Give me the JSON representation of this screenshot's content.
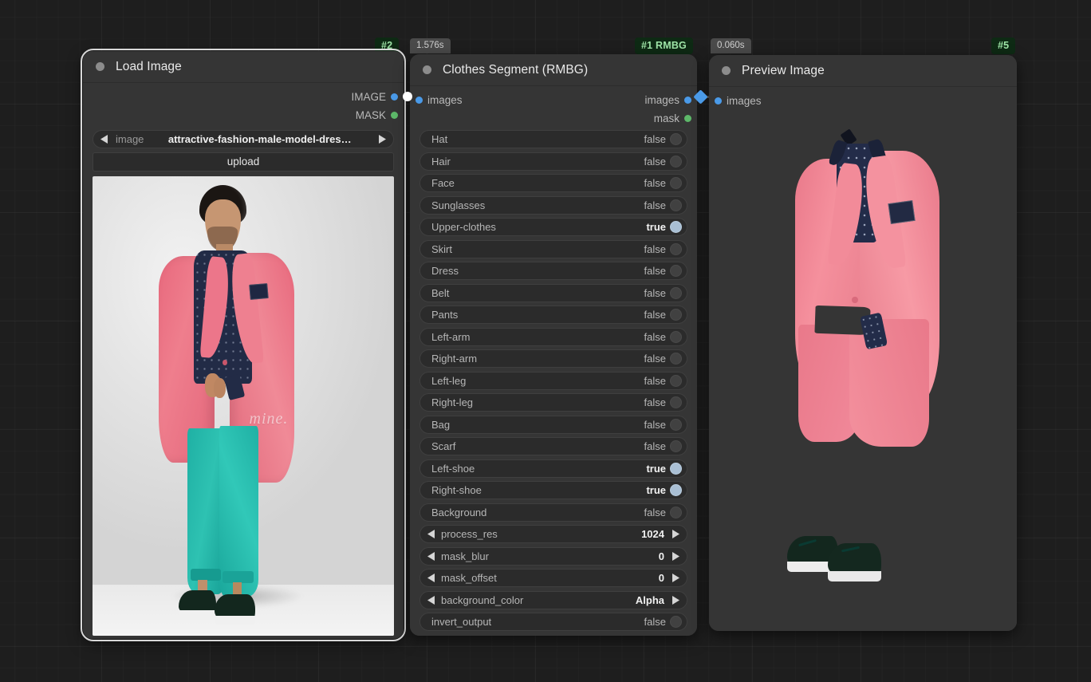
{
  "app": {
    "canvas_label": "node-graph-canvas"
  },
  "nodes": [
    {
      "key": "load_image",
      "title": "Load Image",
      "id_badge": "#2",
      "time_badge": null,
      "selected": true,
      "outputs": [
        {
          "label": "IMAGE",
          "type": "IMAGE",
          "color": "#4a9ae8"
        },
        {
          "label": "MASK",
          "type": "MASK",
          "color": "#5db869"
        }
      ],
      "inputs": [],
      "widgets": [
        {
          "kind": "combo",
          "name": "image",
          "value": "attractive-fashion-male-model-dres…"
        },
        {
          "kind": "button",
          "label": "upload"
        }
      ],
      "preview_alt": "attractive fashion male model in pink blazer, navy shirt, teal trousers and dark derby shoes"
    },
    {
      "key": "clothes_segment",
      "title": "Clothes Segment (RMBG)",
      "id_badge": "#1 RMBG",
      "time_badge": "1.576s",
      "selected": false,
      "inputs": [
        {
          "label": "images",
          "type": "IMAGE",
          "color": "#4a9ae8"
        }
      ],
      "outputs": [
        {
          "label": "images",
          "type": "IMAGE",
          "color": "#4a9ae8"
        },
        {
          "label": "mask",
          "type": "MASK",
          "color": "#5db869"
        }
      ],
      "widgets": [
        {
          "kind": "toggle",
          "name": "Hat",
          "value": "false"
        },
        {
          "kind": "toggle",
          "name": "Hair",
          "value": "false"
        },
        {
          "kind": "toggle",
          "name": "Face",
          "value": "false"
        },
        {
          "kind": "toggle",
          "name": "Sunglasses",
          "value": "false"
        },
        {
          "kind": "toggle",
          "name": "Upper-clothes",
          "value": "true"
        },
        {
          "kind": "toggle",
          "name": "Skirt",
          "value": "false"
        },
        {
          "kind": "toggle",
          "name": "Dress",
          "value": "false"
        },
        {
          "kind": "toggle",
          "name": "Belt",
          "value": "false"
        },
        {
          "kind": "toggle",
          "name": "Pants",
          "value": "false"
        },
        {
          "kind": "toggle",
          "name": "Left-arm",
          "value": "false"
        },
        {
          "kind": "toggle",
          "name": "Right-arm",
          "value": "false"
        },
        {
          "kind": "toggle",
          "name": "Left-leg",
          "value": "false"
        },
        {
          "kind": "toggle",
          "name": "Right-leg",
          "value": "false"
        },
        {
          "kind": "toggle",
          "name": "Bag",
          "value": "false"
        },
        {
          "kind": "toggle",
          "name": "Scarf",
          "value": "false"
        },
        {
          "kind": "toggle",
          "name": "Left-shoe",
          "value": "true"
        },
        {
          "kind": "toggle",
          "name": "Right-shoe",
          "value": "true"
        },
        {
          "kind": "toggle",
          "name": "Background",
          "value": "false"
        },
        {
          "kind": "combo",
          "name": "process_res",
          "value": "1024"
        },
        {
          "kind": "combo",
          "name": "mask_blur",
          "value": "0"
        },
        {
          "kind": "combo",
          "name": "mask_offset",
          "value": "0"
        },
        {
          "kind": "combo",
          "name": "background_color",
          "value": "Alpha"
        },
        {
          "kind": "toggle",
          "name": "invert_output",
          "value": "false"
        }
      ]
    },
    {
      "key": "preview_image",
      "title": "Preview Image",
      "id_badge": "#5",
      "time_badge": "0.060s",
      "selected": false,
      "inputs": [
        {
          "label": "images",
          "type": "IMAGE",
          "color": "#4a9ae8"
        }
      ],
      "outputs": [],
      "widgets": [],
      "preview_alt": "segmented pink blazer with navy shirt and pair of dark derby shoes on transparent background"
    }
  ],
  "colors": {
    "canvas_bg": "#1e1e1e",
    "node_bg": "#353535",
    "widget_bg": "#2b2b2b",
    "image_slot": "#4a9ae8",
    "mask_slot": "#5db869",
    "badge_bg": "#0e2a14",
    "badge_text": "#9fe6a8",
    "toggle_on": "#a9bfd4",
    "selection_outline": "#d8d8d8"
  },
  "links": [
    {
      "from": "load_image.IMAGE",
      "to": "clothes_segment.images",
      "reroute": "dot-white"
    },
    {
      "from": "clothes_segment.images",
      "to": "preview_image.images",
      "reroute": "diamond-blue"
    }
  ]
}
